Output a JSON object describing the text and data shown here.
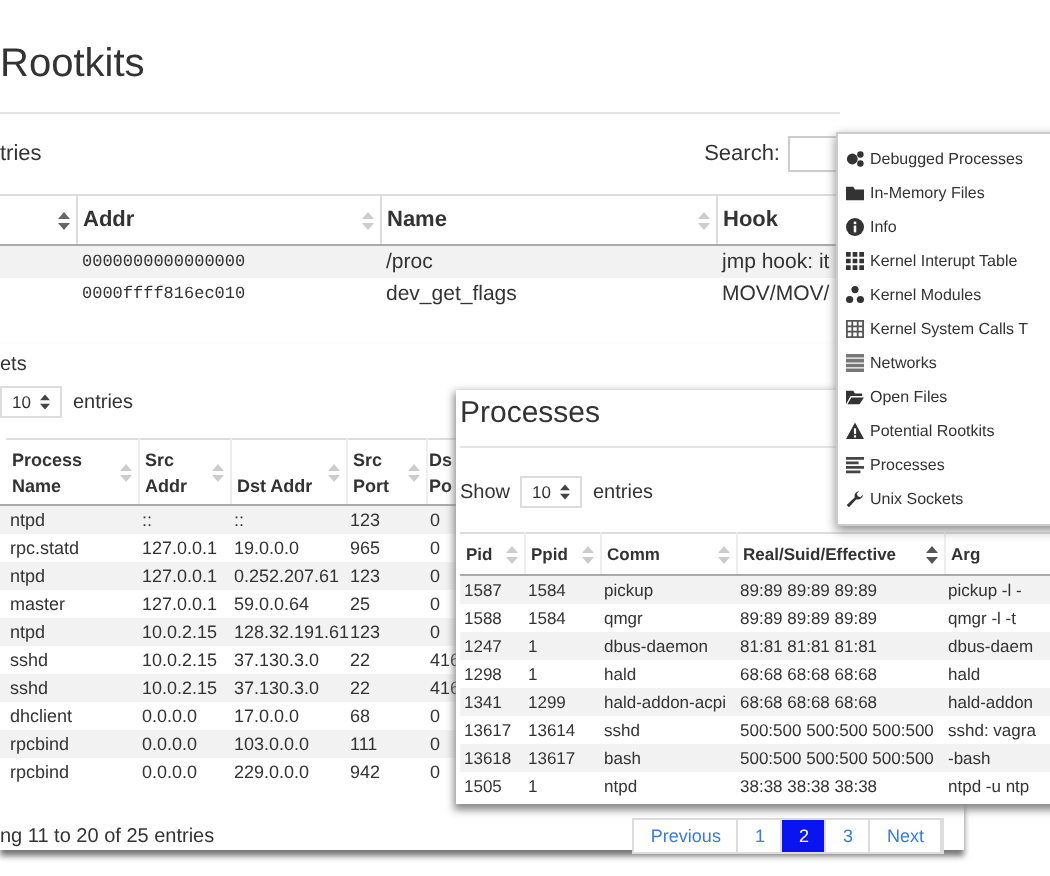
{
  "rootkits": {
    "title": "Rootkits",
    "entries_text": "tries",
    "search_label": "Search:",
    "columns": [
      "Addr",
      "Name",
      "Hook"
    ],
    "rows": [
      [
        "0000000000000000",
        "/proc",
        "jmp hook: it"
      ],
      [
        "0000ffff816ec010",
        "dev_get_flags",
        "MOV/MOV/"
      ]
    ]
  },
  "networks": {
    "title": "ets",
    "length": {
      "value": "10",
      "label": "entries"
    },
    "columns": [
      "Process Name",
      "Src Addr",
      "Dst Addr",
      "Src Port",
      "Ds Po"
    ],
    "rows": [
      [
        "ntpd",
        "::",
        "::",
        "123",
        "0"
      ],
      [
        "rpc.statd",
        "127.0.0.1",
        "19.0.0.0",
        "965",
        "0"
      ],
      [
        "ntpd",
        "127.0.0.1",
        "0.252.207.61",
        "123",
        "0"
      ],
      [
        "master",
        "127.0.0.1",
        "59.0.0.64",
        "25",
        "0"
      ],
      [
        "ntpd",
        "10.0.2.15",
        "128.32.191.61",
        "123",
        "0"
      ],
      [
        "sshd",
        "10.0.2.15",
        "37.130.3.0",
        "22",
        "416"
      ],
      [
        "sshd",
        "10.0.2.15",
        "37.130.3.0",
        "22",
        "416"
      ],
      [
        "dhclient",
        "0.0.0.0",
        "17.0.0.0",
        "68",
        "0"
      ],
      [
        "rpcbind",
        "0.0.0.0",
        "103.0.0.0",
        "111",
        "0"
      ],
      [
        "rpcbind",
        "0.0.0.0",
        "229.0.0.0",
        "942",
        "0"
      ]
    ],
    "info": "ng 11 to 20 of 25 entries",
    "pagination": [
      {
        "label": "Previous",
        "selected": false
      },
      {
        "label": "1",
        "selected": false
      },
      {
        "label": "2",
        "selected": true
      },
      {
        "label": "3",
        "selected": false
      },
      {
        "label": "Next",
        "selected": false
      }
    ]
  },
  "processes": {
    "title": "Processes",
    "length": {
      "prefix": "Show",
      "value": "10",
      "label": "entries"
    },
    "columns": [
      "Pid",
      "Ppid",
      "Comm",
      "Real/Suid/Effective",
      "Arg"
    ],
    "rows": [
      [
        "1587",
        "1584",
        "pickup",
        "89:89 89:89 89:89",
        "pickup -l -"
      ],
      [
        "1588",
        "1584",
        "qmgr",
        "89:89 89:89 89:89",
        "qmgr -l -t"
      ],
      [
        "1247",
        "1",
        "dbus-daemon",
        "81:81 81:81 81:81",
        "dbus-daem"
      ],
      [
        "1298",
        "1",
        "hald",
        "68:68 68:68 68:68",
        "hald"
      ],
      [
        "1341",
        "1299",
        "hald-addon-acpi",
        "68:68 68:68 68:68",
        "hald-addon"
      ],
      [
        "13617",
        "13614",
        "sshd",
        "500:500 500:500 500:500",
        "sshd: vagra"
      ],
      [
        "13618",
        "13617",
        "bash",
        "500:500 500:500 500:500",
        "-bash"
      ],
      [
        "1505",
        "1",
        "ntpd",
        "38:38 38:38 38:38",
        "ntpd -u ntp"
      ]
    ]
  },
  "menu": {
    "items": [
      {
        "label": "Debugged Processes"
      },
      {
        "label": "In-Memory Files"
      },
      {
        "label": "Info"
      },
      {
        "label": "Kernel Interupt Table"
      },
      {
        "label": "Kernel Modules"
      },
      {
        "label": "Kernel System Calls T"
      },
      {
        "label": "Networks"
      },
      {
        "label": "Open Files"
      },
      {
        "label": "Potential Rootkits"
      },
      {
        "label": "Processes"
      },
      {
        "label": "Unix Sockets"
      }
    ]
  }
}
